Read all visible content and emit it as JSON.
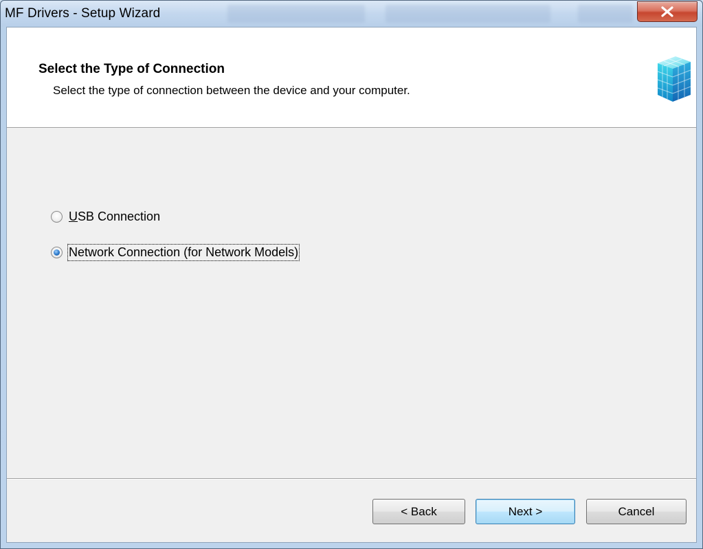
{
  "window": {
    "title": "MF Drivers - Setup Wizard"
  },
  "header": {
    "title": "Select the Type of Connection",
    "subtitle": "Select the type of connection between the device and your computer."
  },
  "options": [
    {
      "label": "USB Connection",
      "mnemonic": "U",
      "checked": false
    },
    {
      "label": "Network Connection (for Network Models)",
      "mnemonic": "C",
      "checked": true
    }
  ],
  "buttons": {
    "back": "< Back",
    "next": "Next >",
    "cancel": "Cancel"
  },
  "icons": {
    "close": "close-icon",
    "wizard": "package-cube-icon"
  },
  "colors": {
    "close_button": "#c7462f",
    "default_button_border": "#3c7fb1"
  }
}
